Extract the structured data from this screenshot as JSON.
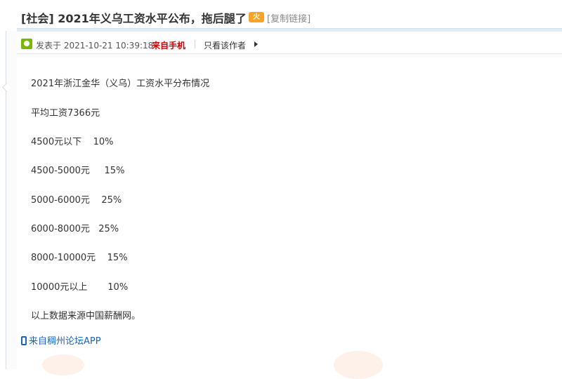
{
  "post": {
    "title": "[社会] 2021年义乌工资水平公布，拖后腿了",
    "title_icon_text": "火",
    "copy_link": "[复制链接]",
    "posted_label": "发表于 2021-10-21 10:39:18",
    "from_label": "来自手机",
    "author_only": "只看该作者",
    "lines": [
      "2021年浙江金华（义乌）工资水平分布情况",
      "平均工资7366元",
      "4500元以下    10%",
      "4500-5000元     15%",
      "5000-6000元    25%",
      "6000-8000元   25%",
      "8000-10000元    15%",
      "10000元以上       10%",
      "以上数据来源中国薪酬网。"
    ],
    "app_link": "来自稠州论坛APP"
  },
  "icons": {
    "title_icon": "hot-badge-icon",
    "meta_icon": "user-icon",
    "arrow_icon": "arrow-right-icon",
    "phone_icon": "phone-icon"
  },
  "colors": {
    "from_red": "#cc0000",
    "link_blue": "#1c64b8",
    "badge_orange": "#f6a326",
    "user_green": "#7ab800"
  }
}
